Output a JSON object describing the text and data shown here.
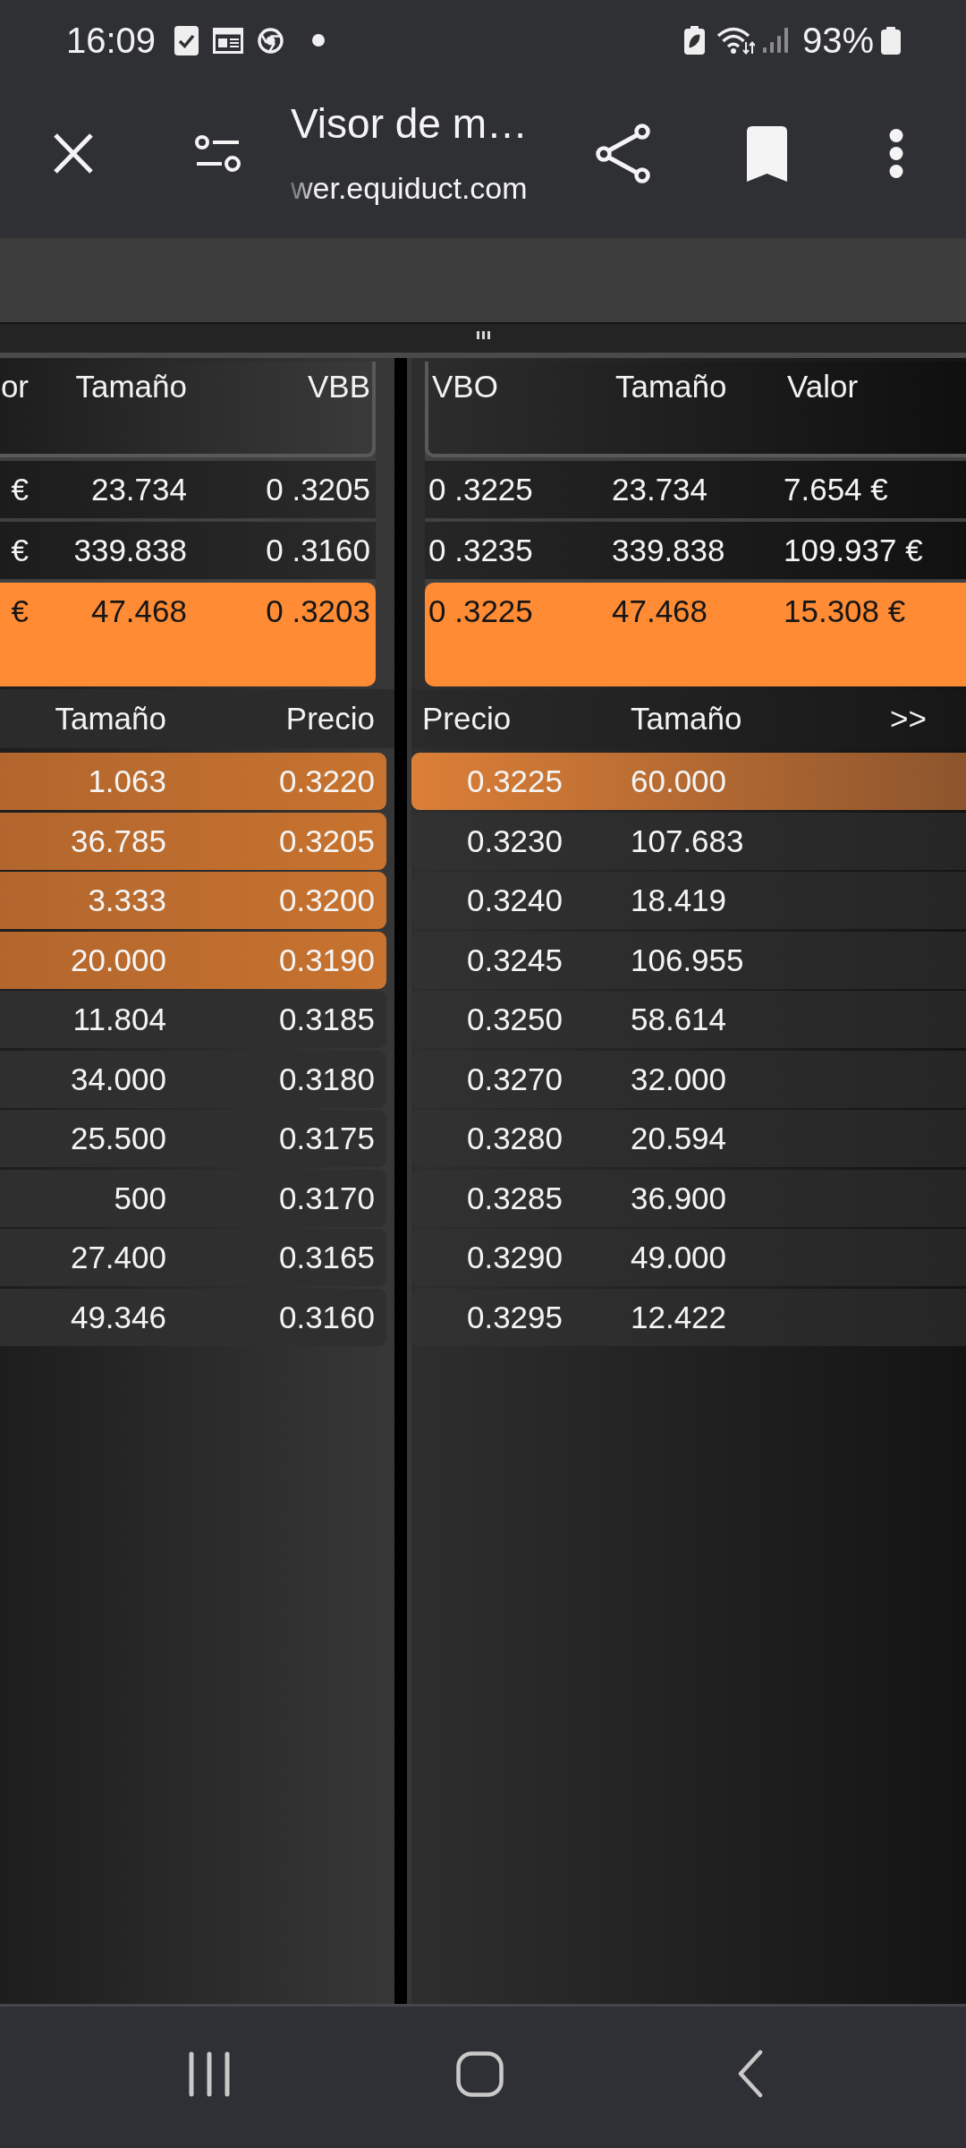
{
  "status_bar": {
    "time": "16:09",
    "battery": "93%"
  },
  "toolbar": {
    "title": "Visor de m…",
    "url": "wer.equiduct.com"
  },
  "best_quotes": {
    "bid": {
      "columns": [
        "or",
        "Tamaño",
        "VBB"
      ],
      "rows": [
        {
          "cells": [
            "€",
            "23.734",
            "0 .3205"
          ],
          "highlighted": false
        },
        {
          "cells": [
            "€",
            "339.838",
            "0 .3160"
          ],
          "highlighted": false
        },
        {
          "cells": [
            "€",
            "47.468",
            "0 .3203"
          ],
          "highlighted": true
        }
      ]
    },
    "ask": {
      "columns": [
        "VBO",
        "Tamaño",
        "Valor"
      ],
      "rows": [
        {
          "cells": [
            "0 .3225",
            "23.734",
            "7.654 €"
          ],
          "highlighted": false
        },
        {
          "cells": [
            "0 .3235",
            "339.838",
            "109.937 €"
          ],
          "highlighted": false
        },
        {
          "cells": [
            "0 .3225",
            "47.468",
            "15.308 €"
          ],
          "highlighted": true
        }
      ]
    }
  },
  "order_book": {
    "bid": {
      "columns": [
        "Tamaño",
        "Precio"
      ],
      "rows": [
        {
          "cells": [
            "1.063",
            "0.3220"
          ],
          "highlighted": true
        },
        {
          "cells": [
            "36.785",
            "0.3205"
          ],
          "highlighted": true
        },
        {
          "cells": [
            "3.333",
            "0.3200"
          ],
          "highlighted": true
        },
        {
          "cells": [
            "20.000",
            "0.3190"
          ],
          "highlighted": true
        },
        {
          "cells": [
            "11.804",
            "0.3185"
          ],
          "highlighted": false
        },
        {
          "cells": [
            "34.000",
            "0.3180"
          ],
          "highlighted": false
        },
        {
          "cells": [
            "25.500",
            "0.3175"
          ],
          "highlighted": false
        },
        {
          "cells": [
            "500",
            "0.3170"
          ],
          "highlighted": false
        },
        {
          "cells": [
            "27.400",
            "0.3165"
          ],
          "highlighted": false
        },
        {
          "cells": [
            "49.346",
            "0.3160"
          ],
          "highlighted": false
        }
      ]
    },
    "ask": {
      "columns": [
        "Precio",
        "Tamaño",
        ">>"
      ],
      "rows": [
        {
          "cells": [
            "0.3225",
            "60.000"
          ],
          "highlighted": true
        },
        {
          "cells": [
            "0.3230",
            "107.683"
          ],
          "highlighted": false
        },
        {
          "cells": [
            "0.3240",
            "18.419"
          ],
          "highlighted": false
        },
        {
          "cells": [
            "0.3245",
            "106.955"
          ],
          "highlighted": false
        },
        {
          "cells": [
            "0.3250",
            "58.614"
          ],
          "highlighted": false
        },
        {
          "cells": [
            "0.3270",
            "32.000"
          ],
          "highlighted": false
        },
        {
          "cells": [
            "0.3280",
            "20.594"
          ],
          "highlighted": false
        },
        {
          "cells": [
            "0.3285",
            "36.900"
          ],
          "highlighted": false
        },
        {
          "cells": [
            "0.3290",
            "49.000"
          ],
          "highlighted": false
        },
        {
          "cells": [
            "0.3295",
            "12.422"
          ],
          "highlighted": false
        }
      ]
    }
  }
}
